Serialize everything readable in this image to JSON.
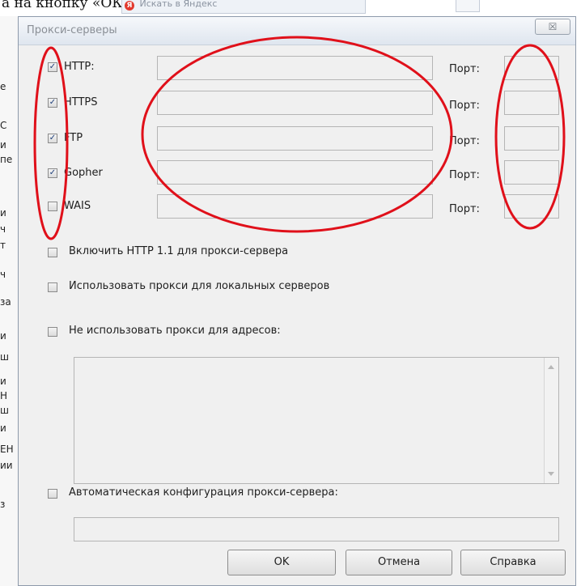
{
  "background": {
    "caption": "а на кнопку «ОК».",
    "search_placeholder": "Искать в Яндекс",
    "search_logo": "Я",
    "strip_fragments": [
      "е",
      "С",
      "и",
      "пе",
      "и",
      "ч",
      "т",
      "ч",
      "за",
      "и",
      "ш",
      "и",
      "Н",
      "ш",
      "и",
      "ЕН",
      "ии",
      "з"
    ]
  },
  "dialog": {
    "title": "Прокси-серверы",
    "close_label": "☒",
    "protocols": [
      {
        "label": "HTTP:",
        "checked": true,
        "server": "",
        "port": "",
        "port_label": "Порт:"
      },
      {
        "label": "HTTPS",
        "checked": true,
        "server": "",
        "port": "",
        "port_label": "Порт:"
      },
      {
        "label": "FTP",
        "checked": true,
        "server": "",
        "port": "",
        "port_label": "Порт:"
      },
      {
        "label": "Gopher",
        "checked": true,
        "server": "",
        "port": "",
        "port_label": "Порт:"
      },
      {
        "label": "WAIS",
        "checked": false,
        "server": "",
        "port": "",
        "port_label": "Порт:"
      }
    ],
    "options": {
      "http11": {
        "label": "Включить HTTP 1.1 для прокси-сервера",
        "checked": false
      },
      "local": {
        "label": "Использовать прокси для локальных серверов",
        "checked": false
      },
      "bypass": {
        "label": "Не использовать прокси для адресов:",
        "checked": false
      },
      "bypass_list": "",
      "autoconfig": {
        "label": "Автоматическая конфигурация прокси-сервера:",
        "checked": false
      },
      "autoconfig_url": ""
    },
    "buttons": {
      "ok": "OK",
      "cancel": "Отмена",
      "help": "Справка"
    }
  },
  "colors": {
    "annotation": "#e0101a",
    "checkmark": "#1d3e7a"
  }
}
